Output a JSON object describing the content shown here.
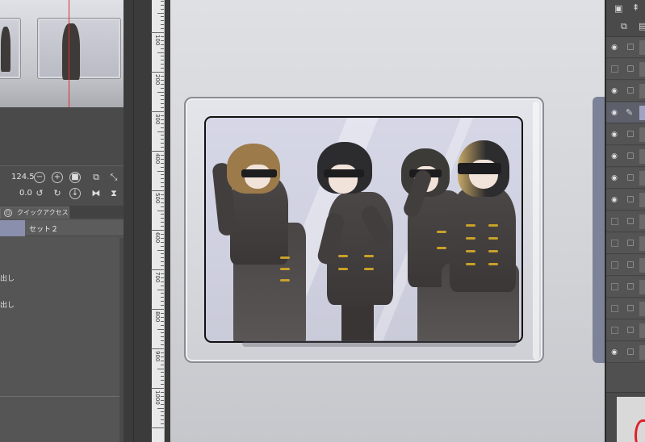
{
  "navigator": {
    "zoom_value": "124.5",
    "rotation_value": "0.0"
  },
  "quick_access": {
    "tab_label": "クイックアクセス",
    "set_name": "セット２",
    "items": [
      "出し",
      "出し"
    ]
  },
  "ruler": {
    "ticks": [
      "100",
      "200",
      "300",
      "400",
      "500",
      "600",
      "700",
      "800",
      "900",
      "1000"
    ]
  },
  "layers": {
    "rows": [
      {
        "visible": true,
        "selected": false
      },
      {
        "visible": false,
        "selected": false
      },
      {
        "visible": true,
        "selected": false
      },
      {
        "visible": true,
        "selected": true,
        "editing": true
      },
      {
        "visible": true,
        "selected": false
      },
      {
        "visible": true,
        "selected": false
      },
      {
        "visible": true,
        "selected": false
      },
      {
        "visible": true,
        "selected": false
      },
      {
        "visible": false,
        "selected": false
      },
      {
        "visible": false,
        "selected": false
      },
      {
        "visible": false,
        "selected": false
      },
      {
        "visible": false,
        "selected": false
      },
      {
        "visible": false,
        "selected": false
      },
      {
        "visible": false,
        "selected": false
      },
      {
        "visible": true,
        "selected": false
      }
    ]
  },
  "icons": {
    "eye": "eye-icon",
    "pen": "pen-icon",
    "zoom_in": "zoom-in-icon",
    "zoom_out": "zoom-out-icon",
    "rotate_left": "rotate-left-icon",
    "rotate_right": "rotate-right-icon"
  },
  "colors": {
    "accent_selection": "#8a8fae",
    "navigator_frame": "#d93030",
    "canvas_bg": "#d3d4d8"
  }
}
